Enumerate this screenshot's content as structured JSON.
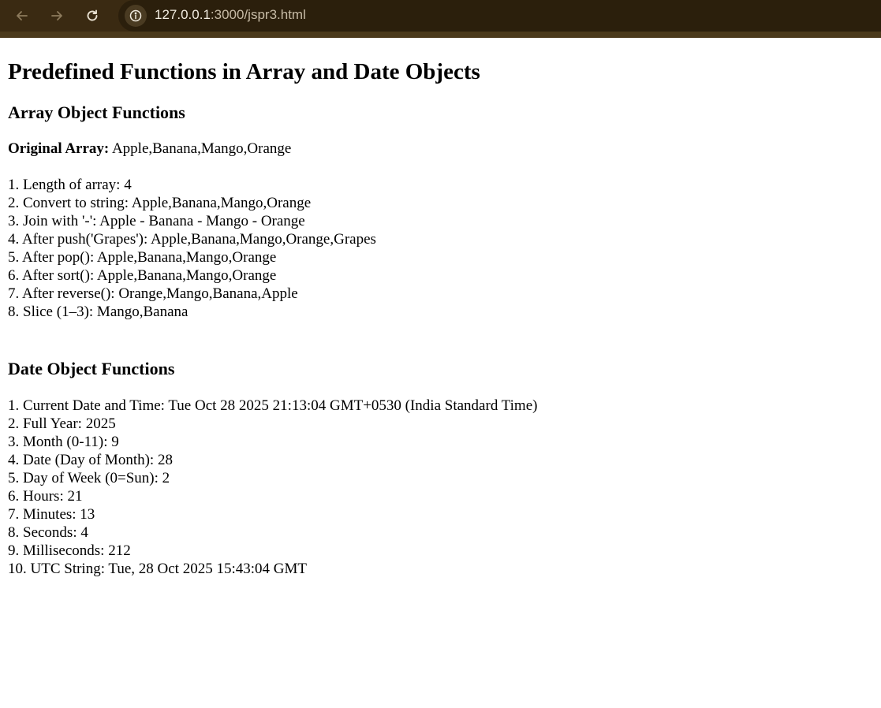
{
  "browser": {
    "url_host": "127.0.0.1",
    "url_rest": ":3000/jspr3.html"
  },
  "page": {
    "title": "Predefined Functions in Array and Date Objects",
    "array_heading": "Array Object Functions",
    "original_label": "Original Array:",
    "original_value": "Apple,Banana,Mango,Orange",
    "array_lines": [
      "1. Length of array: 4",
      "2. Convert to string: Apple,Banana,Mango,Orange",
      "3. Join with '-': Apple - Banana - Mango - Orange",
      "4. After push('Grapes'): Apple,Banana,Mango,Orange,Grapes",
      "5. After pop(): Apple,Banana,Mango,Orange",
      "6. After sort(): Apple,Banana,Mango,Orange",
      "7. After reverse(): Orange,Mango,Banana,Apple",
      "8. Slice (1–3): Mango,Banana"
    ],
    "date_heading": "Date Object Functions",
    "date_lines": [
      "1. Current Date and Time: Tue Oct 28 2025 21:13:04 GMT+0530 (India Standard Time)",
      "2. Full Year: 2025",
      "3. Month (0-11): 9",
      "4. Date (Day of Month): 28",
      "5. Day of Week (0=Sun): 2",
      "6. Hours: 21",
      "7. Minutes: 13",
      "8. Seconds: 4",
      "9. Milliseconds: 212",
      "10. UTC String: Tue, 28 Oct 2025 15:43:04 GMT"
    ]
  }
}
